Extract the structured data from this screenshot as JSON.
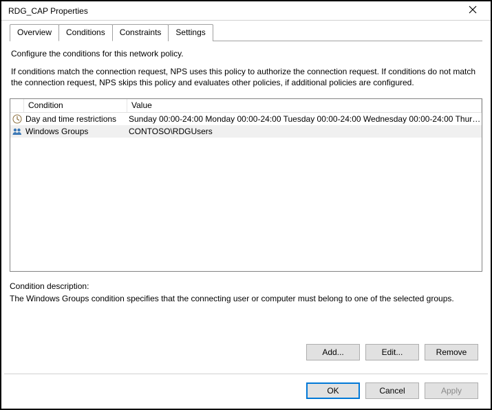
{
  "window": {
    "title": "RDG_CAP Properties"
  },
  "tabs": {
    "items": [
      "Overview",
      "Conditions",
      "Constraints",
      "Settings"
    ],
    "active_index": 1
  },
  "instructions": {
    "line1": "Configure the conditions for this network policy.",
    "line2": "If conditions match the connection request, NPS uses this policy to authorize the connection request. If conditions do not match the connection request, NPS skips this policy and evaluates other policies, if additional policies are configured."
  },
  "list": {
    "headers": {
      "condition": "Condition",
      "value": "Value"
    },
    "rows": [
      {
        "icon": "clock",
        "condition": "Day and time restrictions",
        "value": "Sunday 00:00-24:00 Monday 00:00-24:00 Tuesday 00:00-24:00 Wednesday 00:00-24:00 Thursd...",
        "selected": false
      },
      {
        "icon": "group",
        "condition": "Windows Groups",
        "value": "CONTOSO\\RDGUsers",
        "selected": true
      }
    ]
  },
  "description": {
    "label": "Condition description:",
    "text": "The Windows Groups condition specifies that the connecting user or computer must belong to one of the selected groups."
  },
  "buttons": {
    "add": "Add...",
    "edit": "Edit...",
    "remove": "Remove",
    "ok": "OK",
    "cancel": "Cancel",
    "apply": "Apply"
  }
}
